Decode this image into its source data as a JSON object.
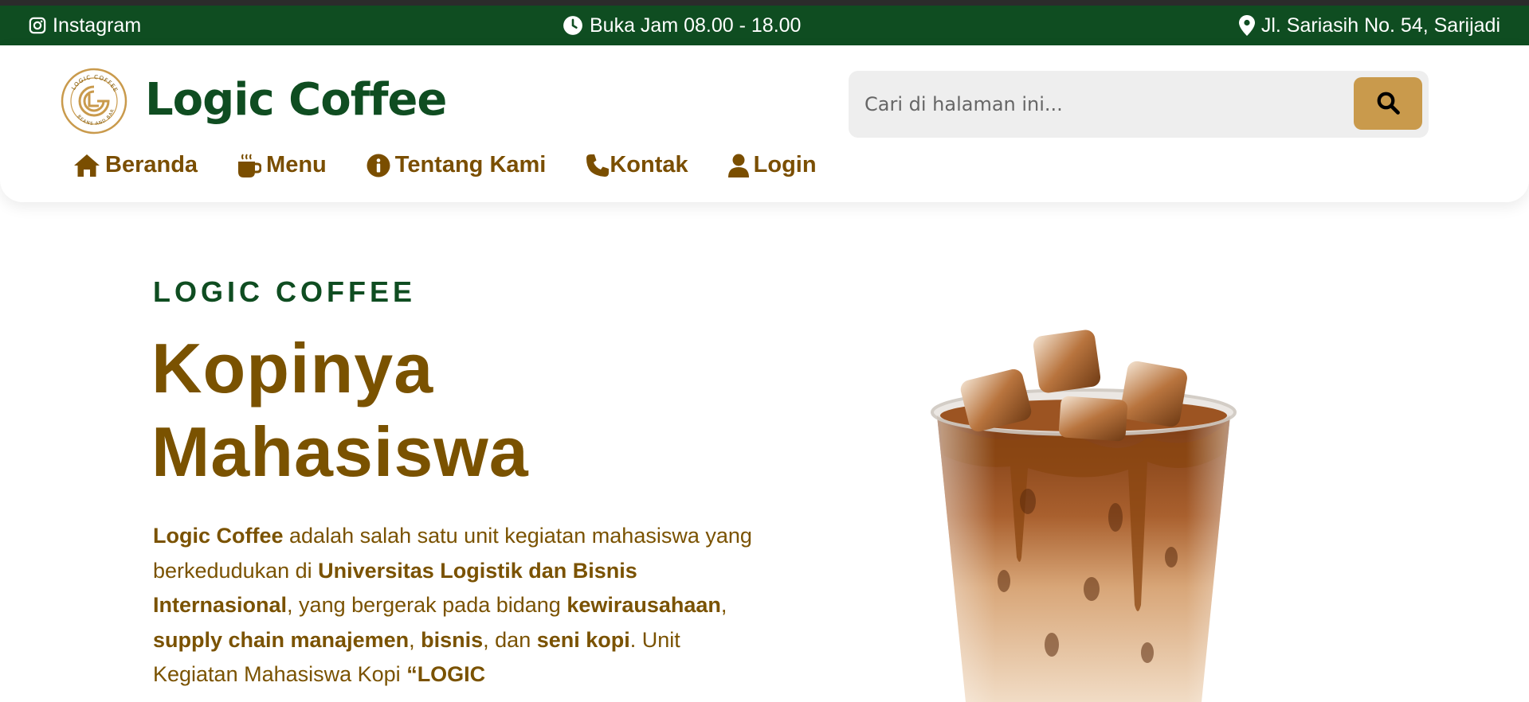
{
  "topbar": {
    "instagram_label": "Instagram",
    "hours_label": "Buka Jam 08.00 - 18.00",
    "address_label": "Jl. Sariasih No. 54, Sarijadi",
    "icons": [
      "instagram-icon",
      "clock-icon",
      "map-pin-icon"
    ]
  },
  "header": {
    "logo": {
      "icon": "logic-coffee-logo",
      "ring_text_top": "LOGIC COFFEE",
      "ring_text_bottom": "BEANS AND BAR"
    },
    "brand_name": "Logic Coffee",
    "search": {
      "placeholder": "Cari di halaman ini...",
      "value": "",
      "icon": "search-icon"
    },
    "nav": [
      {
        "label": "Beranda",
        "icon": "home-icon"
      },
      {
        "label": "Menu",
        "icon": "mug-icon"
      },
      {
        "label": "Tentang Kami",
        "icon": "info-icon"
      },
      {
        "label": "Kontak",
        "icon": "phone-icon"
      },
      {
        "label": "Login",
        "icon": "user-icon"
      }
    ]
  },
  "hero": {
    "eyebrow": "LOGIC COFFEE",
    "headline_line1": "Kopinya",
    "headline_line2": "Mahasiswa",
    "paragraph": {
      "t1": "Logic Coffee",
      "t2": " adalah salah satu unit kegiatan mahasiswa yang berkedudukan di ",
      "t3": "Universitas Logistik dan Bisnis Internasional",
      "t4": ", yang bergerak pada bidang ",
      "t5": "kewirausahaan",
      "t6": ", ",
      "t7": "supply chain manajemen",
      "t8": ", ",
      "t9": "bisnis",
      "t10": ", dan ",
      "t11": "seni kopi",
      "t12": ". Unit Kegiatan Mahasiswa Kopi ",
      "t13": "“LOGIC"
    },
    "image": "iced-caramel-coffee-cup"
  },
  "colors": {
    "topbar_bg": "#0f4d21",
    "brand_green": "#0f4d21",
    "accent_brown": "#7a5200",
    "search_button": "#c99a4c"
  }
}
